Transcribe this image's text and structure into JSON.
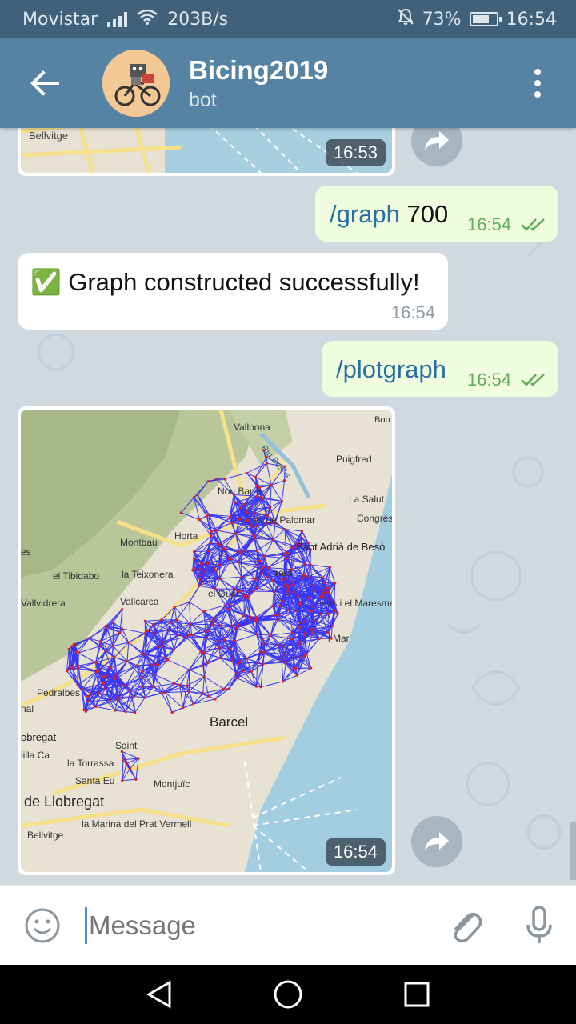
{
  "status_bar": {
    "carrier": "Movistar",
    "net_speed": "203B/s",
    "battery": "73%",
    "battery_level": 0.73,
    "clock": "16:54"
  },
  "header": {
    "title": "Bicing2019",
    "subtitle": "bot"
  },
  "messages": [
    {
      "kind": "photo",
      "direction": "in",
      "time": "16:53"
    },
    {
      "kind": "text",
      "direction": "out",
      "command": "/graph",
      "arg": " 700",
      "time": "16:54"
    },
    {
      "kind": "text",
      "direction": "in",
      "emoji": "✅",
      "text": "Graph constructed successfully!",
      "time": "16:54"
    },
    {
      "kind": "text",
      "direction": "out",
      "command": "/plotgraph",
      "time": "16:54"
    },
    {
      "kind": "photo",
      "direction": "in",
      "time": "16:54"
    }
  ],
  "map_labels": {
    "bellvitge": "Bellvitge",
    "vallbona": "Vallbona",
    "riu_besos": "Riu Besòs",
    "bon": "Bon",
    "puigfred": "Puigfred",
    "nou_barris": "Nou Barris",
    "la_salut": "La Salut",
    "congres": "Congrés",
    "palomar": "eu de Palomar",
    "montbau": "Montbau",
    "horta": "Horta",
    "sant_adria": "Sant Adrià de Besò",
    "es": "es",
    "tibidabo": "el Tibidabo",
    "teixonera": "la Teixonera",
    "rera": "rera",
    "vallvidrera": "Vallvidrera",
    "vallcarca": "Vallcarca",
    "el_guin": "el Guin",
    "maresme": "esòs i el Maresme",
    "mar": "l Mar",
    "pedralbes": "Pedralbes",
    "nal": "nal",
    "obregat": "obregat",
    "barcelona": "Barcel",
    "saint": "Saint",
    "villa_ca": "iilla Ca",
    "torrassa": "la Torrassa",
    "santa_eu": "Santa Eu",
    "montjuic": "Montjuïc",
    "de_llobregat": "de Llobregat",
    "marina": "la Marina del Prat Vermell",
    "bellvitge2": "Bellvitge"
  },
  "composer": {
    "placeholder": "Message"
  }
}
